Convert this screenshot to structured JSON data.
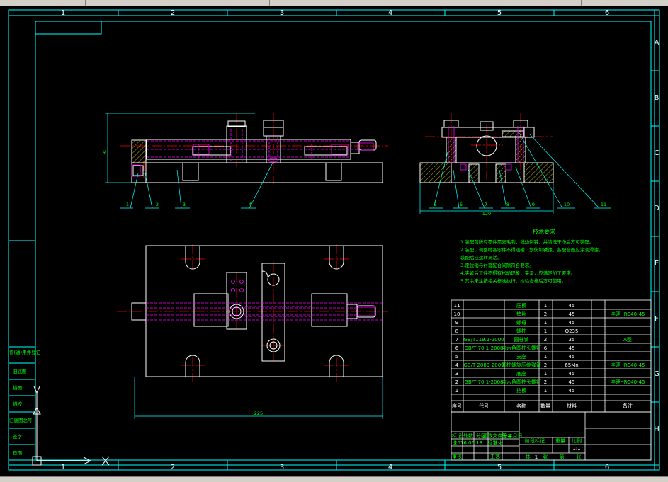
{
  "zones": {
    "columns": [
      "1",
      "2",
      "3",
      "4",
      "5",
      "6"
    ],
    "rows": [
      "A",
      "B",
      "C",
      "D",
      "E",
      "F",
      "G",
      "H"
    ]
  },
  "dimensions": {
    "height": "80",
    "side_width": "120",
    "plan_width": "225"
  },
  "balloons": [
    "1",
    "2",
    "3",
    "4",
    "5",
    "6",
    "7",
    "8",
    "9",
    "10",
    "11"
  ],
  "tech_requirements": {
    "title": "技术要求",
    "lines": [
      "1.装配前所有零件需去毛刺、锐边倒钝，并清洗干净后方可装配。",
      "2.装配、调整时各零件不得磕碰、划伤和锈蚀，各配合面应涂润滑油。",
      "   装配后应运转灵活。",
      "3.定位销与衬套配合间隙符合要求。",
      "4.夹紧后工件不得有松动现象，夹紧力应满足加工要求。",
      "5.其余未注按相关标准执行，检验合格后方可使用。"
    ]
  },
  "parts_header": [
    "序号",
    "代号",
    "名称",
    "数量",
    "材料",
    "备注"
  ],
  "parts": [
    {
      "no": "11",
      "code": "",
      "name": "压板",
      "qty": "1",
      "mat": "45",
      "note": ""
    },
    {
      "no": "10",
      "code": "",
      "name": "垫片",
      "qty": "2",
      "mat": "45",
      "note": "淬硬HRC40-45"
    },
    {
      "no": "9",
      "code": "",
      "name": "螺母",
      "qty": "1",
      "mat": "45",
      "note": ""
    },
    {
      "no": "8",
      "code": "",
      "name": "螺柱",
      "qty": "1",
      "mat": "Q235",
      "note": ""
    },
    {
      "no": "7",
      "code": "GB/T119.1-2000",
      "name": "圆柱销",
      "qty": "2",
      "mat": "35",
      "note": "A型"
    },
    {
      "no": "6",
      "code": "GB/T 70.1-2008",
      "name": "内六角圆柱头螺钉",
      "qty": "6",
      "mat": "45",
      "note": ""
    },
    {
      "no": "5",
      "code": "",
      "name": "支座",
      "qty": "1",
      "mat": "45",
      "note": ""
    },
    {
      "no": "4",
      "code": "GB/T 2089-2009",
      "name": "圆柱螺旋压缩弹簧",
      "qty": "2",
      "mat": "65Mn",
      "note": "淬硬HRC40-45"
    },
    {
      "no": "3",
      "code": "",
      "name": "底座",
      "qty": "1",
      "mat": "45",
      "note": ""
    },
    {
      "no": "2",
      "code": "GB/T 70.1-2008",
      "name": "内六角圆柱头螺钉",
      "qty": "2",
      "mat": "45",
      "note": "淬硬HRC40-45"
    },
    {
      "no": "1",
      "code": "",
      "name": "挡板",
      "qty": "1",
      "mat": "45",
      "note": ""
    }
  ],
  "left_strip": [
    "借(通)用件登记",
    "旧底图",
    "描图",
    "描校",
    "旧底图总号",
    "签字",
    "日期"
  ],
  "title_block": {
    "row1": [
      "标记",
      "处数",
      "分区",
      "更改文件号",
      "签名",
      "年月日"
    ],
    "stage": [
      "阶段标记",
      "重量",
      "比例"
    ],
    "scale": "1:1",
    "row_design": [
      "设计",
      "标准化"
    ],
    "row_audit": [
      "审核",
      "工艺"
    ],
    "date": "2016.06.18",
    "sheet": [
      "共",
      "张",
      "第",
      "张"
    ],
    "sheet_value": "1"
  },
  "colors": {
    "border": "#00ffff",
    "text": "#00ff00",
    "centerline": "#ff0000",
    "hidden": "#ff00ff",
    "outline": "#ffffff",
    "hatch": "#ffff00"
  }
}
